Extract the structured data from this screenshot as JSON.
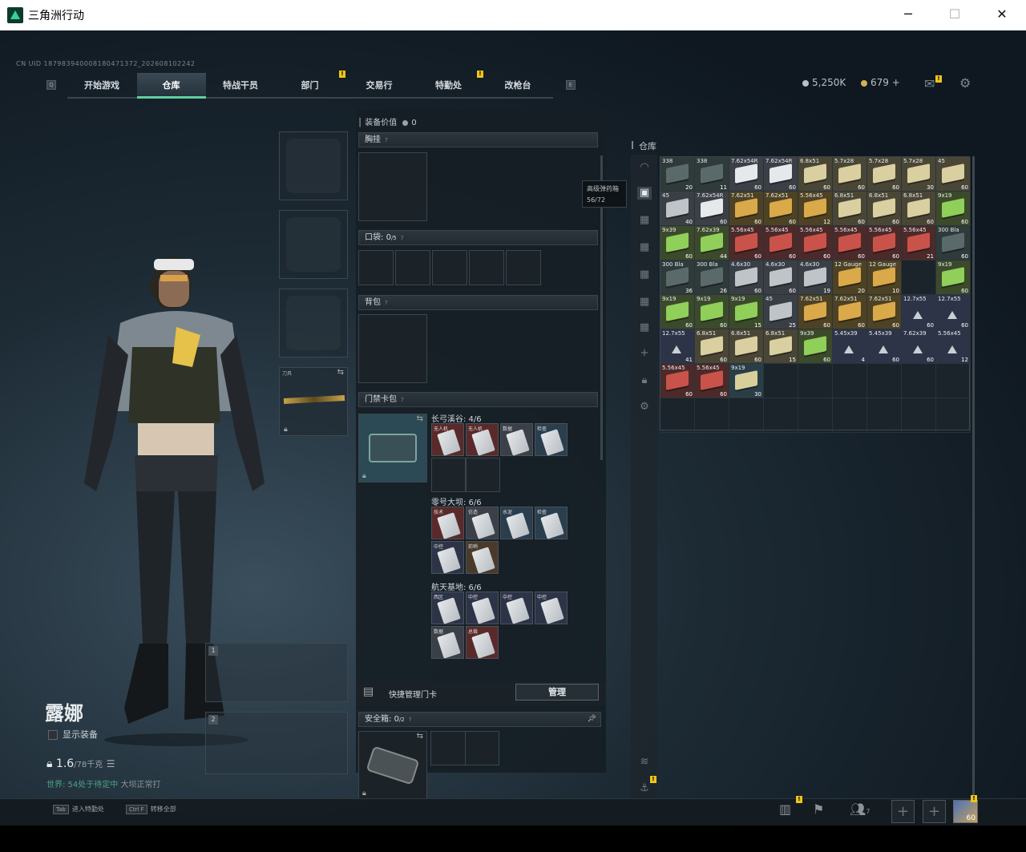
{
  "window": {
    "title": "三角洲行动",
    "minimize": "─",
    "maximize": "☐",
    "close": "✕"
  },
  "uid": "CN UID 187983940008180471372_202608102242",
  "nav": {
    "left_key": "Q",
    "right_key": "E",
    "tabs": [
      "开始游戏",
      "仓库",
      "特战干员",
      "部门",
      "交易行",
      "特勤处",
      "改枪台"
    ],
    "active": "仓库",
    "badge": "!"
  },
  "currency": {
    "silver": "5,250K",
    "gold": "679",
    "plus": "+"
  },
  "character": {
    "name": "露娜",
    "show_gear_label": "显示装备",
    "weight": "1.6",
    "weight_max": "/78千克",
    "status_green": "世界: 54处于待定中",
    "status_grey": "大坝正常打"
  },
  "equip_slots": {
    "melee_label": "刀具"
  },
  "weapon_slots": [
    "1",
    "2"
  ],
  "mid": {
    "value_label": "装备价值",
    "value": "0",
    "chest_rig": "胸挂",
    "pocket": "口袋:",
    "pocket_count": "0",
    "pocket_max": "/5",
    "backpack": "背包",
    "keycard_pack": "门禁卡包",
    "help": "?",
    "maps": [
      {
        "name": "长弓溪谷: 4/6",
        "cards": [
          "无人机",
          "无人机",
          "数据",
          "检查"
        ]
      },
      {
        "name": "零号大坝: 6/6",
        "cards": [
          "技术",
          "仿造",
          "水泥",
          "检查",
          "中控",
          "前哨"
        ]
      },
      {
        "name": "航天基地: 6/6",
        "cards": [
          "西区",
          "中控",
          "中控",
          "中控",
          "数据",
          "总裁"
        ]
      }
    ],
    "quick_manage": "快捷管理门卡",
    "manage_btn": "管理",
    "safe_box": "安全箱:",
    "safe_count": "0",
    "safe_max": "/2"
  },
  "warehouse": {
    "label": "仓库",
    "tooltip_title": "高级弹药箱",
    "tooltip_count": "56/72",
    "rows": [
      [
        {
          "n": "338",
          "c": "20",
          "k": "dark"
        },
        {
          "n": "338",
          "c": "11",
          "k": "dark"
        },
        {
          "n": "7.62x54R",
          "c": "60",
          "k": "white"
        },
        {
          "n": "7.62x54R",
          "c": "60",
          "k": "white"
        },
        {
          "n": "6.8x51",
          "c": "60",
          "k": "cream"
        },
        {
          "n": "5.7x28",
          "c": "60",
          "k": "cream"
        },
        {
          "n": "5.7x28",
          "c": "60",
          "k": "cream"
        },
        {
          "n": "5.7x28",
          "c": "30",
          "k": "cream"
        },
        {
          "n": "45",
          "c": "60",
          "k": "cream"
        }
      ],
      [
        {
          "n": "45",
          "c": "40",
          "k": "grey"
        },
        {
          "n": "7.62x54R",
          "c": "60",
          "k": "white"
        },
        {
          "n": "7.62x51",
          "c": "60",
          "k": "yellow"
        },
        {
          "n": "7.62x51",
          "c": "60",
          "k": "yellow"
        },
        {
          "n": "5.56x45",
          "c": "12",
          "k": "yellow"
        },
        {
          "n": "6.8x51",
          "c": "60",
          "k": "cream"
        },
        {
          "n": "6.8x51",
          "c": "60",
          "k": "cream"
        },
        {
          "n": "6.8x51",
          "c": "60",
          "k": "cream"
        },
        {
          "n": "9x19",
          "c": "60",
          "k": "green"
        }
      ],
      [
        {
          "n": "9x39",
          "c": "60",
          "k": "green"
        },
        {
          "n": "7.62x39",
          "c": "44",
          "k": "green"
        },
        {
          "n": "5.56x45",
          "c": "60",
          "k": "red"
        },
        {
          "n": "5.56x45",
          "c": "60",
          "k": "red"
        },
        {
          "n": "5.56x45",
          "c": "60",
          "k": "red"
        },
        {
          "n": "5.56x45",
          "c": "60",
          "k": "red"
        },
        {
          "n": "5.56x45",
          "c": "60",
          "k": "red"
        },
        {
          "n": "5.56x45",
          "c": "21",
          "k": "red"
        },
        {
          "n": "300 Bla",
          "c": "60",
          "k": "dark"
        }
      ],
      [
        {
          "n": "300 Bla",
          "c": "36",
          "k": "dark"
        },
        {
          "n": "300 Bla",
          "c": "26",
          "k": "dark"
        },
        {
          "n": "4.6x30",
          "c": "60",
          "k": "grey"
        },
        {
          "n": "4.6x30",
          "c": "60",
          "k": "grey"
        },
        {
          "n": "4.6x30",
          "c": "19",
          "k": "grey"
        },
        {
          "n": "12 Gauge",
          "c": "20",
          "k": "yellow"
        },
        {
          "n": "12 Gauge",
          "c": "10",
          "k": "yellow"
        },
        {
          "n": "",
          "c": "",
          "k": "empty"
        },
        {
          "n": "9x19",
          "c": "60",
          "k": "green"
        }
      ],
      [
        {
          "n": "9x19",
          "c": "60",
          "k": "green"
        },
        {
          "n": "9x19",
          "c": "60",
          "k": "green"
        },
        {
          "n": "9x19",
          "c": "15",
          "k": "green"
        },
        {
          "n": "45",
          "c": "25",
          "k": "grey"
        },
        {
          "n": "7.62x51",
          "c": "60",
          "k": "yellow"
        },
        {
          "n": "7.62x51",
          "c": "60",
          "k": "yellow"
        },
        {
          "n": "7.62x51",
          "c": "60",
          "k": "yellow"
        },
        {
          "n": "12.7x55",
          "c": "60",
          "k": "tri"
        },
        {
          "n": "12.7x55",
          "c": "60",
          "k": "tri"
        }
      ],
      [
        {
          "n": "12.7x55",
          "c": "41",
          "k": "tri"
        },
        {
          "n": "6.8x51",
          "c": "60",
          "k": "cream"
        },
        {
          "n": "6.8x51",
          "c": "60",
          "k": "cream"
        },
        {
          "n": "6.8x51",
          "c": "15",
          "k": "cream"
        },
        {
          "n": "9x39",
          "c": "60",
          "k": "green"
        },
        {
          "n": "5.45x39",
          "c": "4",
          "k": "tri"
        },
        {
          "n": "5.45x39",
          "c": "60",
          "k": "tri"
        },
        {
          "n": "7.62x39",
          "c": "60",
          "k": "tri"
        },
        {
          "n": "5.56x45",
          "c": "12",
          "k": "tri"
        }
      ],
      [
        {
          "n": "5.56x45",
          "c": "60",
          "k": "red"
        },
        {
          "n": "5.56x45",
          "c": "60",
          "k": "red"
        },
        {
          "n": "9x19",
          "c": "30",
          "k": "teal"
        }
      ]
    ]
  },
  "hints": [
    {
      "key": "Tab",
      "label": "进入特勤处"
    },
    {
      "key": "Ctrl F",
      "label": "转移全部"
    }
  ],
  "bottom": {
    "friends_count": "7",
    "level": "60"
  },
  "colors": {
    "accent": "#5fcfa0",
    "badge": "#f0c419"
  }
}
